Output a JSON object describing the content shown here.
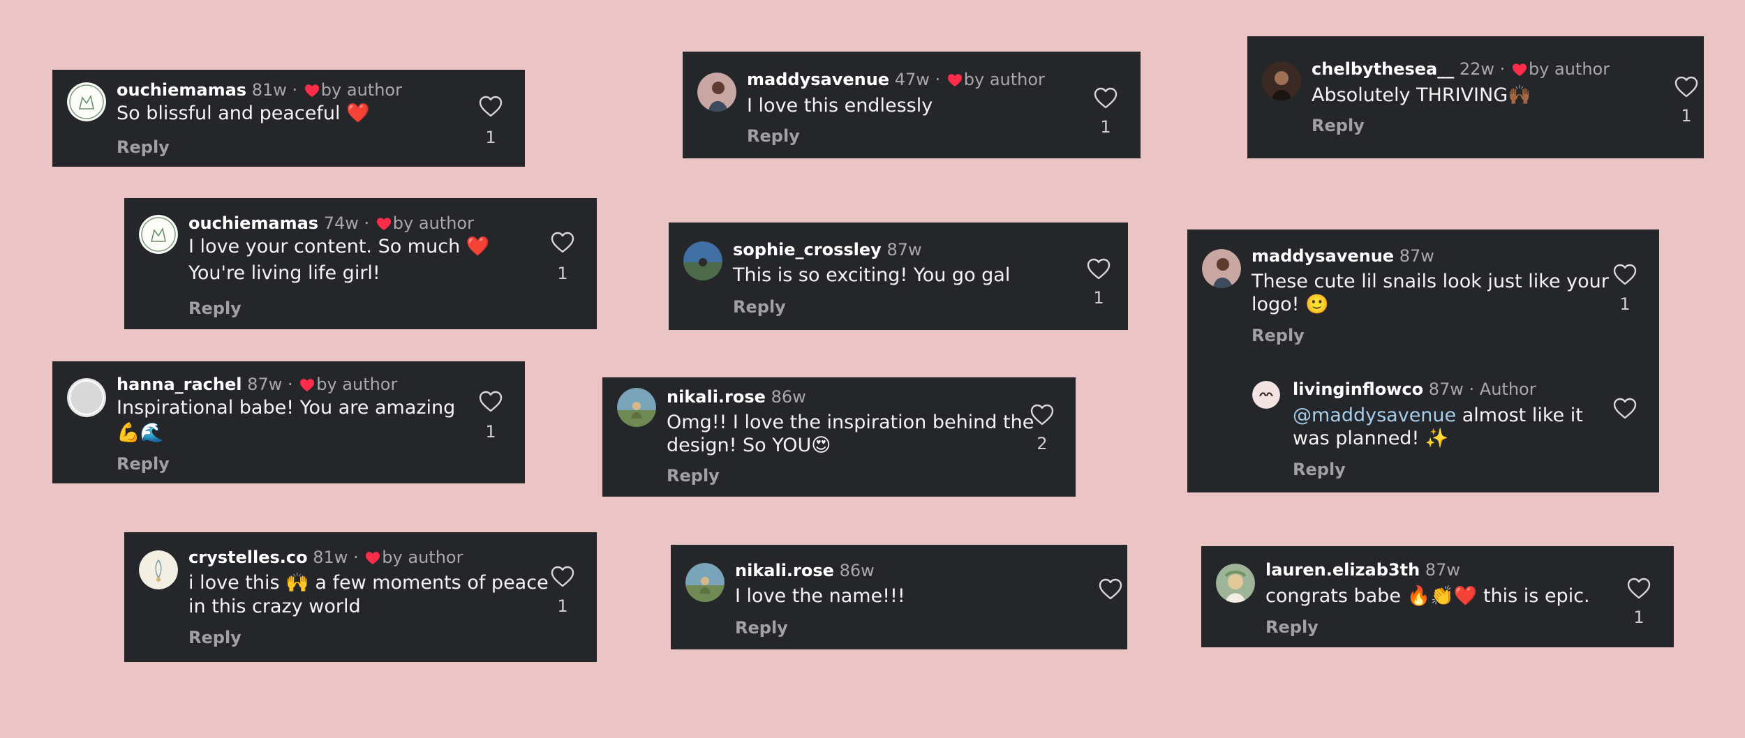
{
  "colors": {
    "background": "#ebc5c6",
    "card": "#25262a",
    "heart_red": "#ff2c4a",
    "mention": "#a5cdea"
  },
  "comments": [
    {
      "user": "ouchiemamas",
      "time": "81w",
      "by_author": "by author",
      "text": "So blissful and peaceful ❤️",
      "reply": "Reply",
      "likes": "1"
    },
    {
      "user": "ouchiemamas",
      "time": "74w",
      "by_author": "by author",
      "text1": "I love your content. So much ❤️",
      "text2": "You're living life girl!",
      "reply": "Reply",
      "likes": "1"
    },
    {
      "user": "hanna_rachel",
      "time": "87w",
      "by_author": "by author",
      "text1": "Inspirational babe! You are amazing",
      "text2": "💪🌊",
      "reply": "Reply",
      "likes": "1"
    },
    {
      "user": "crystelles.co",
      "time": "81w",
      "by_author": "by author",
      "text1": "i love this 🙌 a few moments of peace",
      "text2": "in this crazy world",
      "reply": "Reply",
      "likes": "1"
    },
    {
      "user": "maddysavenue",
      "time": "47w",
      "by_author": "by author",
      "text": "I love this endlessly",
      "reply": "Reply",
      "likes": "1"
    },
    {
      "user": "sophie_crossley",
      "time": "87w",
      "text": "This is so exciting! You go gal",
      "reply": "Reply",
      "likes": "1"
    },
    {
      "user": "nikali.rose",
      "time": "86w",
      "text1": "Omg!! I love the inspiration behind the",
      "text2": "design! So YOU😍",
      "reply": "Reply",
      "likes": "2"
    },
    {
      "user": "nikali.rose",
      "time": "86w",
      "text": "I love the name!!!",
      "reply": "Reply"
    },
    {
      "user": "chelbythesea__",
      "time": "22w",
      "by_author": "by author",
      "text": "Absolutely THRIVING🙌🏾",
      "reply": "Reply",
      "likes": "1"
    },
    {
      "user": "maddysavenue",
      "time": "87w",
      "text1": "These cute lil snails look just like your",
      "text2": "logo! 🙂",
      "reply": "Reply",
      "likes": "1",
      "reply_comment": {
        "user": "livinginflowco",
        "time": "87w · Author",
        "mention": "@maddysavenue",
        "text1": " almost like it",
        "text2": "was planned! ✨",
        "reply": "Reply"
      }
    },
    {
      "user": "lauren.elizab3th",
      "time": "87w",
      "text": "congrats babe 🔥👏❤️ this is epic.",
      "reply": "Reply",
      "likes": "1"
    }
  ]
}
